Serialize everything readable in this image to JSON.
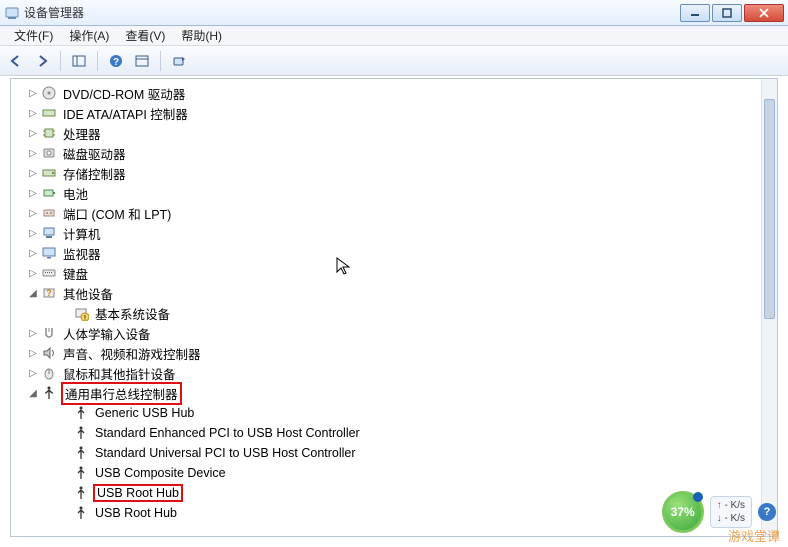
{
  "window": {
    "title": "设备管理器"
  },
  "menubar": [
    "文件(F)",
    "操作(A)",
    "查看(V)",
    "帮助(H)"
  ],
  "tree": {
    "dvd": {
      "label": "DVD/CD-ROM 驱动器"
    },
    "ide": {
      "label": "IDE ATA/ATAPI 控制器"
    },
    "cpu": {
      "label": "处理器"
    },
    "disk": {
      "label": "磁盘驱动器"
    },
    "storage": {
      "label": "存储控制器"
    },
    "battery": {
      "label": "电池"
    },
    "ports": {
      "label": "端口 (COM 和 LPT)"
    },
    "computer": {
      "label": "计算机"
    },
    "monitor": {
      "label": "监视器"
    },
    "keyboard": {
      "label": "键盘"
    },
    "other": {
      "label": "其他设备",
      "child": {
        "label": "基本系统设备"
      }
    },
    "hid": {
      "label": "人体学输入设备"
    },
    "sound": {
      "label": "声音、视频和游戏控制器"
    },
    "mouse": {
      "label": "鼠标和其他指针设备"
    },
    "usb": {
      "label": "通用串行总线控制器",
      "children": [
        "Generic USB Hub",
        "Standard Enhanced PCI to USB Host Controller",
        "Standard Universal PCI to USB Host Controller",
        "USB Composite Device",
        "USB Root Hub",
        "USB Root Hub"
      ]
    }
  },
  "highlight": {
    "category_index": "usb",
    "child_index": 4
  },
  "net": {
    "pct": "37%",
    "up": "- K/s",
    "down": "- K/s"
  },
  "watermark": "游戏堂谭"
}
